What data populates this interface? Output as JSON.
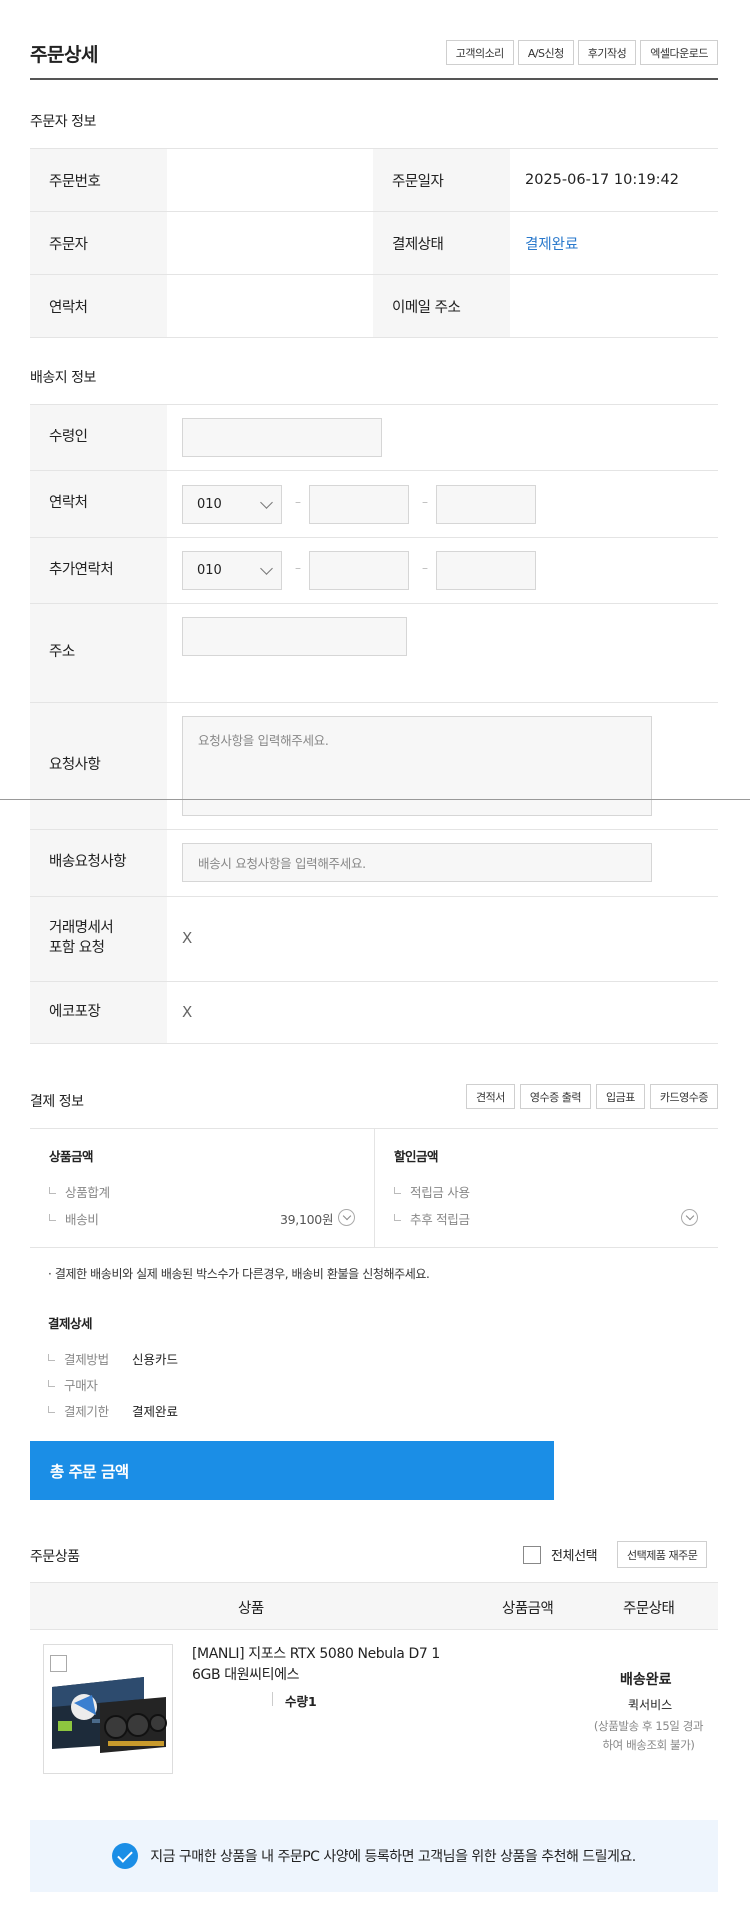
{
  "header": {
    "title": "주문상세",
    "buttons": [
      "고객의소리",
      "A/S신청",
      "후기작성",
      "엑셀다운로드"
    ]
  },
  "orderer_info": {
    "section_title": "주문자 정보",
    "order_number_label": "주문번호",
    "order_date_label": "주문일자",
    "order_date": "2025-06-17 10:19:42",
    "orderer_label": "주문자",
    "payment_status_label": "결제상태",
    "payment_status": "결제완료",
    "contact_label": "연락처",
    "email_label": "이메일 주소"
  },
  "shipping_info": {
    "section_title": "배송지 정보",
    "recipient_label": "수령인",
    "contact_label": "연락처",
    "contact_prefix": "010",
    "extra_contact_label": "추가연락처",
    "extra_contact_prefix": "010",
    "address_label": "주소",
    "request_label": "요청사항",
    "request_placeholder": "요청사항을 입력해주세요.",
    "delivery_request_label": "배송요청사항",
    "delivery_request_placeholder": "배송시 요청사항을 입력해주세요.",
    "statement_label_1": "거래명세서",
    "statement_label_2": "포함 요청",
    "statement_value": "X",
    "eco_label": "에코포장",
    "eco_value": "X"
  },
  "payment_info": {
    "section_title": "결제 정보",
    "buttons": [
      "견적서",
      "영수증 출력",
      "입금표",
      "카드영수증"
    ],
    "product_amount_head": "상품금액",
    "product_total_label": "상품합계",
    "shipping_fee_label": "배송비",
    "shipping_fee_value": "39,100원",
    "discount_head": "할인금액",
    "points_use_label": "적립금 사용",
    "future_points_label": "추후 적립금",
    "note": "· 결제한 배송비와 실제 배송된 박스수가 다른경우, 배송비 환불을 신청해주세요.",
    "detail_head": "결제상세",
    "method_label": "결제방법",
    "method_value": "신용카드",
    "buyer_label": "구매자",
    "deadline_label": "결제기한",
    "deadline_value": "결제완료",
    "total_label": "총 주문 금액"
  },
  "products": {
    "section_title": "주문상품",
    "select_all_label": "전체선택",
    "reorder_button": "선택제품 재주문",
    "col_product": "상품",
    "col_price": "상품금액",
    "col_status": "주문상태",
    "items": [
      {
        "name_line1": "[MANLI] 지포스 RTX 5080 Nebula D7 1",
        "name_line2": "6GB 대원씨티에스",
        "quantity": "수량1",
        "status": "배송완료",
        "carrier": "퀵서비스",
        "status_note_1": "(상품발송 후 15일 경과",
        "status_note_2": "하여 배송조회 불가)"
      }
    ]
  },
  "recommend_banner": "지금 구매한 상품을 내 주문PC 사양에 등록하면 고객님을 위한 상품을 추천해 드릴게요.",
  "colors": {
    "accent": "#1b8ee6",
    "status_blue": "#2a79cc",
    "banner_bg": "#eef5fd"
  }
}
